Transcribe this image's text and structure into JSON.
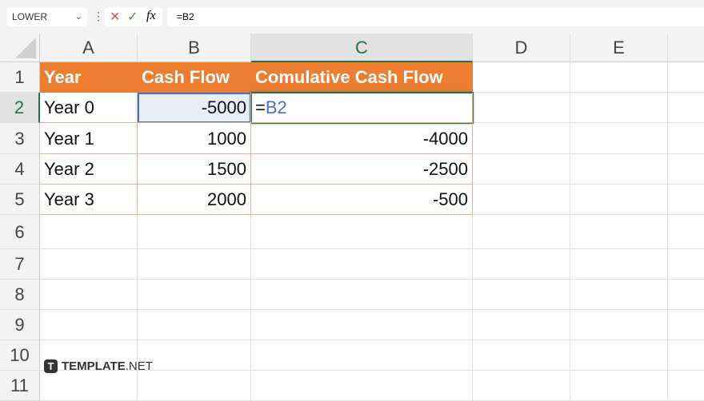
{
  "toolbar": {
    "name_box": "LOWER",
    "formula": "=B2",
    "cancel": "✕",
    "enter": "✓",
    "fx": "fx"
  },
  "columns": [
    "A",
    "B",
    "C",
    "D",
    "E"
  ],
  "rows": [
    "1",
    "2",
    "3",
    "4",
    "5",
    "6",
    "7",
    "8",
    "9",
    "10",
    "11"
  ],
  "table": {
    "headers": [
      "Year",
      "Cash Flow",
      "Comulative Cash Flow"
    ],
    "rows": [
      {
        "year": "Year 0",
        "cash": "-5000",
        "cum": "=B2"
      },
      {
        "year": "Year 1",
        "cash": "1000",
        "cum": "-4000"
      },
      {
        "year": "Year 2",
        "cash": "1500",
        "cum": "-2500"
      },
      {
        "year": "Year 3",
        "cash": "2000",
        "cum": "-500"
      }
    ]
  },
  "watermark": {
    "brand": "TEMPLATE",
    "suffix": ".NET"
  },
  "colors": {
    "header": "#ed7d31",
    "selection": "#217346",
    "ref": "#4472c4"
  }
}
